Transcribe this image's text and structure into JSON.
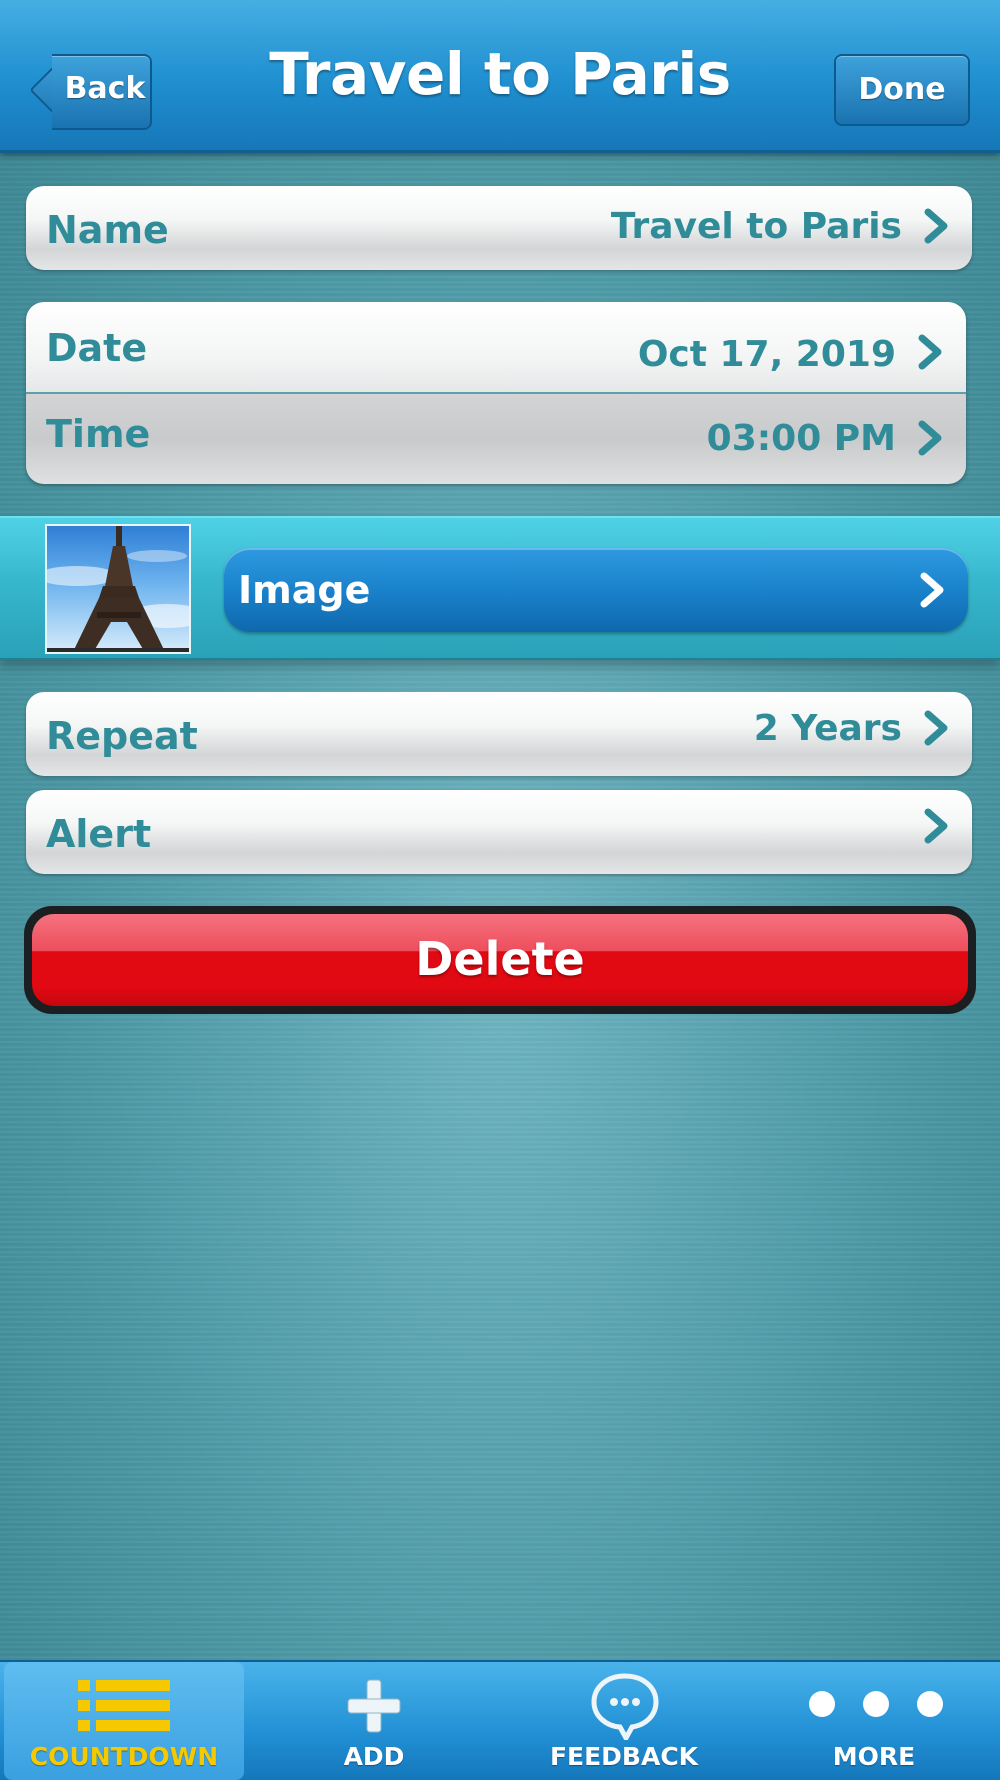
{
  "header": {
    "title": "Travel to Paris",
    "back_label": "Back",
    "done_label": "Done"
  },
  "fields": {
    "name": {
      "label": "Name",
      "value": "Travel to Paris"
    },
    "date": {
      "label": "Date",
      "value": "Oct 17, 2019"
    },
    "time": {
      "label": "Time",
      "value": "03:00 PM"
    },
    "image": {
      "label": "Image"
    },
    "repeat": {
      "label": "Repeat",
      "value": "2 Years"
    },
    "alert": {
      "label": "Alert",
      "value": ""
    }
  },
  "delete_label": "Delete",
  "tabbar": {
    "items": [
      {
        "label": "COUNTDOWN",
        "icon": "list-icon",
        "active": true
      },
      {
        "label": "ADD",
        "icon": "plus-icon",
        "active": false
      },
      {
        "label": "FEEDBACK",
        "icon": "speech-bubble-icon",
        "active": false
      },
      {
        "label": "MORE",
        "icon": "more-dots-icon",
        "active": false
      }
    ]
  },
  "colors": {
    "accent_blue": "#1f8fd0",
    "text_teal": "#2f8c98",
    "delete_red": "#e10912",
    "active_tab": "#f5c800"
  }
}
